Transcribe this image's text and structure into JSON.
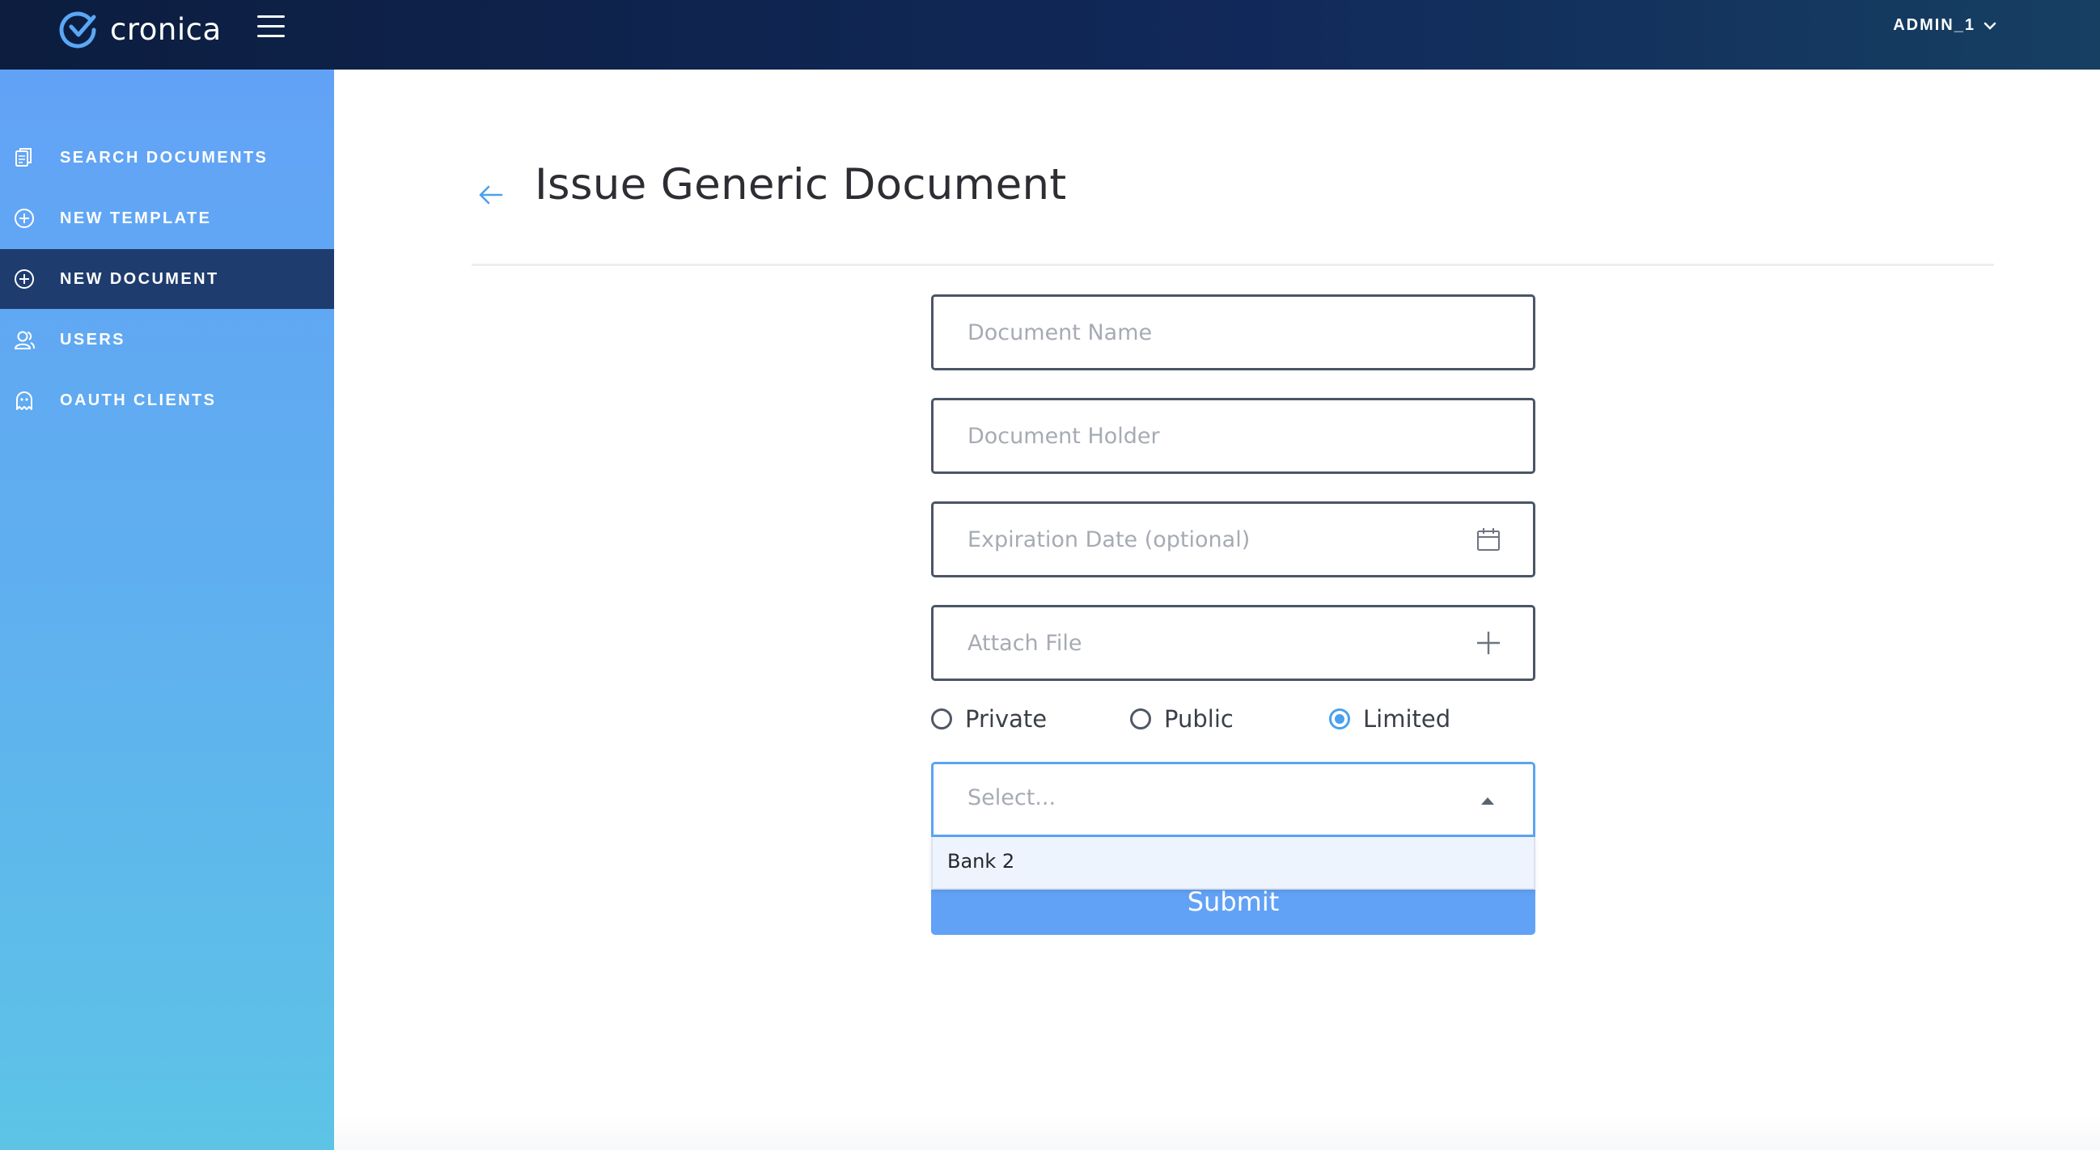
{
  "app": {
    "name": "cronica"
  },
  "header": {
    "user_label": "ADMIN_1"
  },
  "sidebar": {
    "items": [
      {
        "label": "SEARCH DOCUMENTS",
        "icon": "documents-icon"
      },
      {
        "label": "NEW TEMPLATE",
        "icon": "plus-circle-icon"
      },
      {
        "label": "NEW DOCUMENT",
        "icon": "plus-circle-icon",
        "active": true
      },
      {
        "label": "USERS",
        "icon": "users-icon"
      },
      {
        "label": "OAUTH CLIENTS",
        "icon": "ghost-icon"
      }
    ]
  },
  "main": {
    "title": "Issue Generic Document",
    "form": {
      "document_name_placeholder": "Document Name",
      "document_holder_placeholder": "Document Holder",
      "expiration_placeholder": "Expiration Date (optional)",
      "attach_placeholder": "Attach File",
      "visibility": {
        "options": [
          "Private",
          "Public",
          "Limited"
        ],
        "selected": "Limited"
      },
      "select": {
        "placeholder": "Select...",
        "options": [
          "Bank 2"
        ]
      },
      "submit_label": "Submit"
    }
  },
  "colors": {
    "topbar": "#0c1d3f",
    "sidebar": "#62a2f6",
    "sidebar_active": "#1e3c6e",
    "accent": "#4aa1ef",
    "submit": "#62a2f6"
  }
}
